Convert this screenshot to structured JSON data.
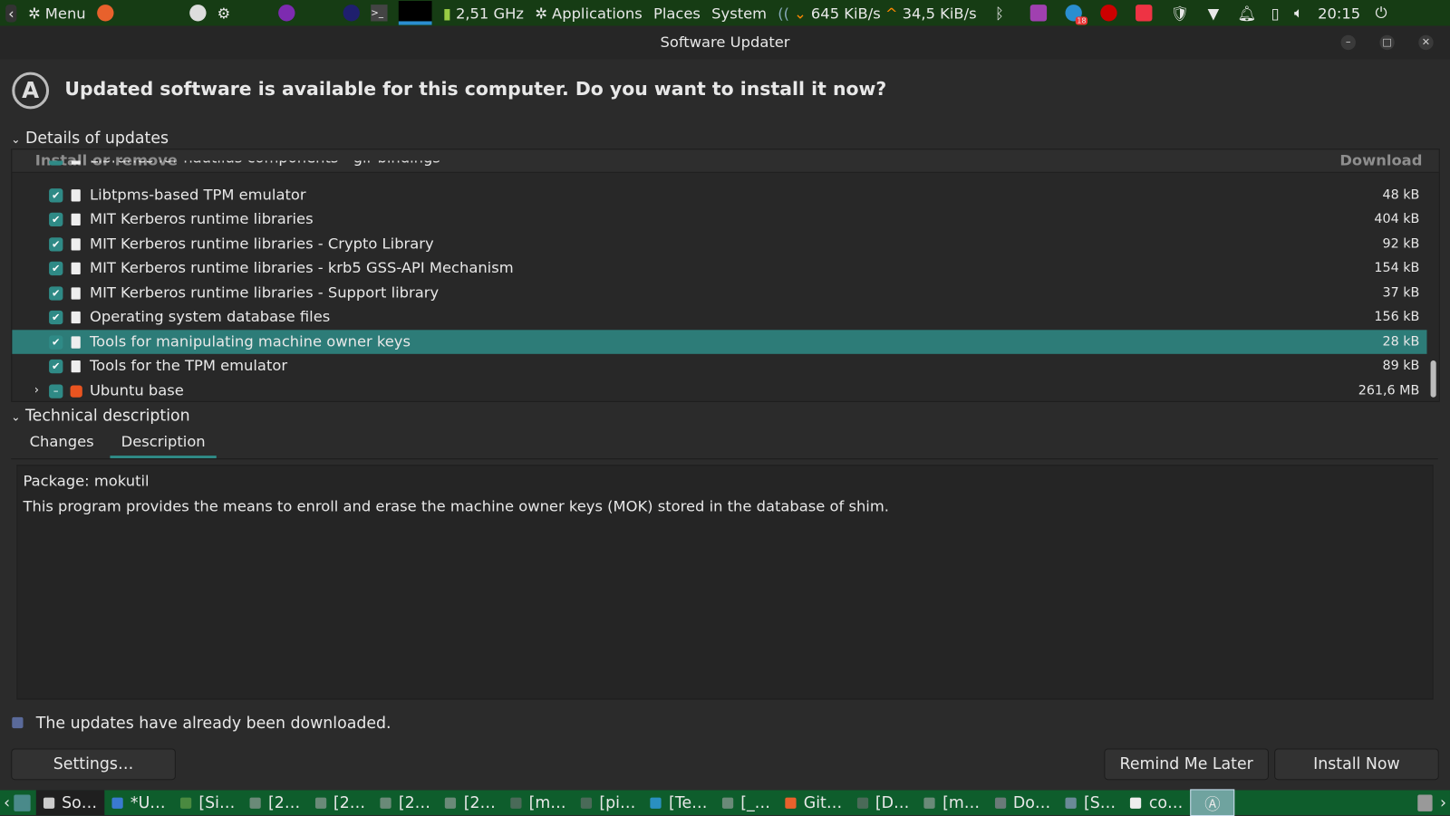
{
  "top_panel": {
    "menu": "Menu",
    "cpu": "2,51 GHz",
    "applications": "Applications",
    "places": "Places",
    "system": "System",
    "net_down": "645 KiB/s",
    "net_up": "34,5 KiB/s",
    "badge": "18",
    "clock": "20:15"
  },
  "window": {
    "title": "Software Updater",
    "headline": "Updated software is available for this computer. Do you want to install it now?"
  },
  "details": {
    "label": "Details of updates",
    "col_name": "Install or remove",
    "col_size": "Download",
    "rows": [
      {
        "name": "Libraries for nautilus components - gir bindings",
        "size": "",
        "checked": true
      },
      {
        "name": "Libtpms-based TPM emulator",
        "size": "48 kB",
        "checked": true
      },
      {
        "name": "MIT Kerberos runtime libraries",
        "size": "404 kB",
        "checked": true
      },
      {
        "name": "MIT Kerberos runtime libraries - Crypto Library",
        "size": "92 kB",
        "checked": true
      },
      {
        "name": "MIT Kerberos runtime libraries - krb5 GSS-API Mechanism",
        "size": "154 kB",
        "checked": true
      },
      {
        "name": "MIT Kerberos runtime libraries - Support library",
        "size": "37 kB",
        "checked": true
      },
      {
        "name": "Operating system database files",
        "size": "156 kB",
        "checked": true
      },
      {
        "name": "Tools for manipulating machine owner keys",
        "size": "28 kB",
        "checked": true,
        "selected": true
      },
      {
        "name": "Tools for the TPM emulator",
        "size": "89 kB",
        "checked": true
      },
      {
        "name": "Ubuntu base",
        "size": "261,6 MB",
        "checked": "mixed",
        "group": true
      }
    ]
  },
  "technical": {
    "label": "Technical description",
    "tabs": [
      "Changes",
      "Description"
    ],
    "active_tab": "Description",
    "package": "Package: mokutil",
    "description": "This program provides the means to enroll and erase the machine owner keys (MOK) stored in the database of shim."
  },
  "status": "The updates have already been downloaded.",
  "buttons": {
    "settings": "Settings…",
    "remind": "Remind Me Later",
    "install": "Install Now"
  },
  "taskbar": [
    "So…",
    "*U…",
    "[Si…",
    "[2…",
    "[2…",
    "[2…",
    "[2…",
    "[m…",
    "[pi…",
    "[Te…",
    "[_…",
    "Git…",
    "[D…",
    "[m…",
    "Do…",
    "[S…",
    "co…"
  ]
}
